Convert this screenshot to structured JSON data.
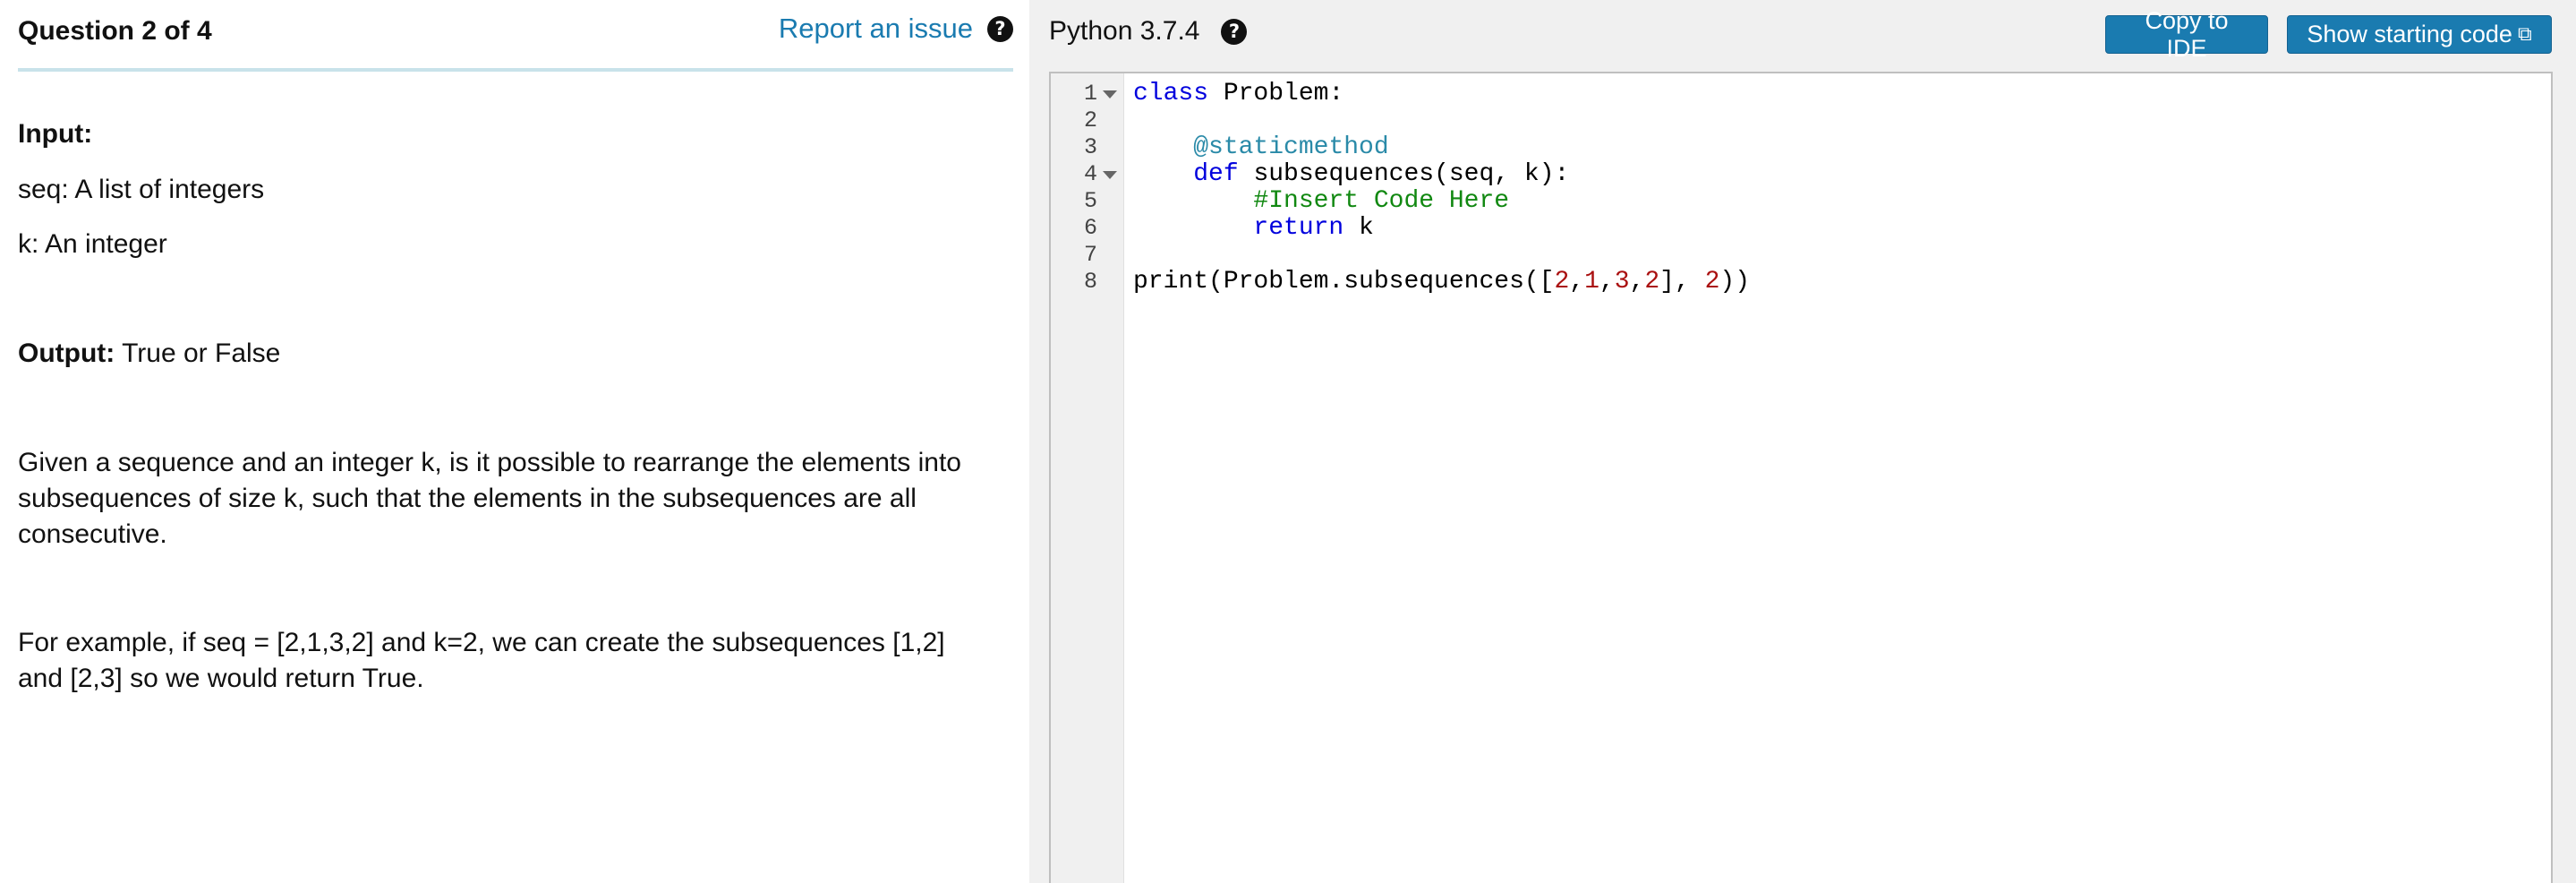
{
  "question": {
    "title": "Question 2 of 4",
    "report_label": "Report an issue",
    "help_glyph": "?"
  },
  "description": {
    "input_heading": "Input:",
    "input_seq": "seq: A list of integers",
    "input_k": "k: An integer",
    "output_heading": "Output:",
    "output_value": " True or False",
    "paragraph1_line1": "Given a sequence and an integer k, is it possible to rearrange the elements into",
    "paragraph1_line2": "subsequences of size k, such that the elements in the subsequences are all",
    "paragraph1_line3": "consecutive.",
    "paragraph2_line1": "For example, if seq = [2,1,3,2] and k=2, we can create the subsequences [1,2]",
    "paragraph2_line2": "and [2,3] so we would return True."
  },
  "editor": {
    "language": "Python 3.7.4",
    "help_glyph": "?",
    "copy_label": "Copy to IDE",
    "start_label": "Show starting code",
    "external_glyph": "⧉",
    "line_numbers": [
      "1",
      "2",
      "3",
      "4",
      "5",
      "6",
      "7",
      "8"
    ],
    "code": {
      "l1_kw": "class",
      "l1_rest": " Problem:",
      "l3_indent": "    ",
      "l3_dec": "@staticmethod",
      "l4_indent": "    ",
      "l4_kw": "def",
      "l4_rest": " subsequences(seq, k):",
      "l5_indent": "        ",
      "l5_cm": "#Insert Code Here",
      "l6_indent": "        ",
      "l6_kw": "return",
      "l6_rest": " k",
      "l8_a": "print(Problem.subsequences([",
      "l8_n1": "2",
      "l8_c1": ",",
      "l8_n2": "1",
      "l8_c2": ",",
      "l8_n3": "3",
      "l8_c3": ",",
      "l8_n4": "2",
      "l8_b": "], ",
      "l8_n5": "2",
      "l8_c": "))"
    }
  },
  "colors": {
    "link": "#1a7bb0",
    "button": "#1a7bb0",
    "keyword": "#0000dd",
    "decorator": "#2a8aa8",
    "comment": "#118811",
    "number": "#aa1111"
  }
}
